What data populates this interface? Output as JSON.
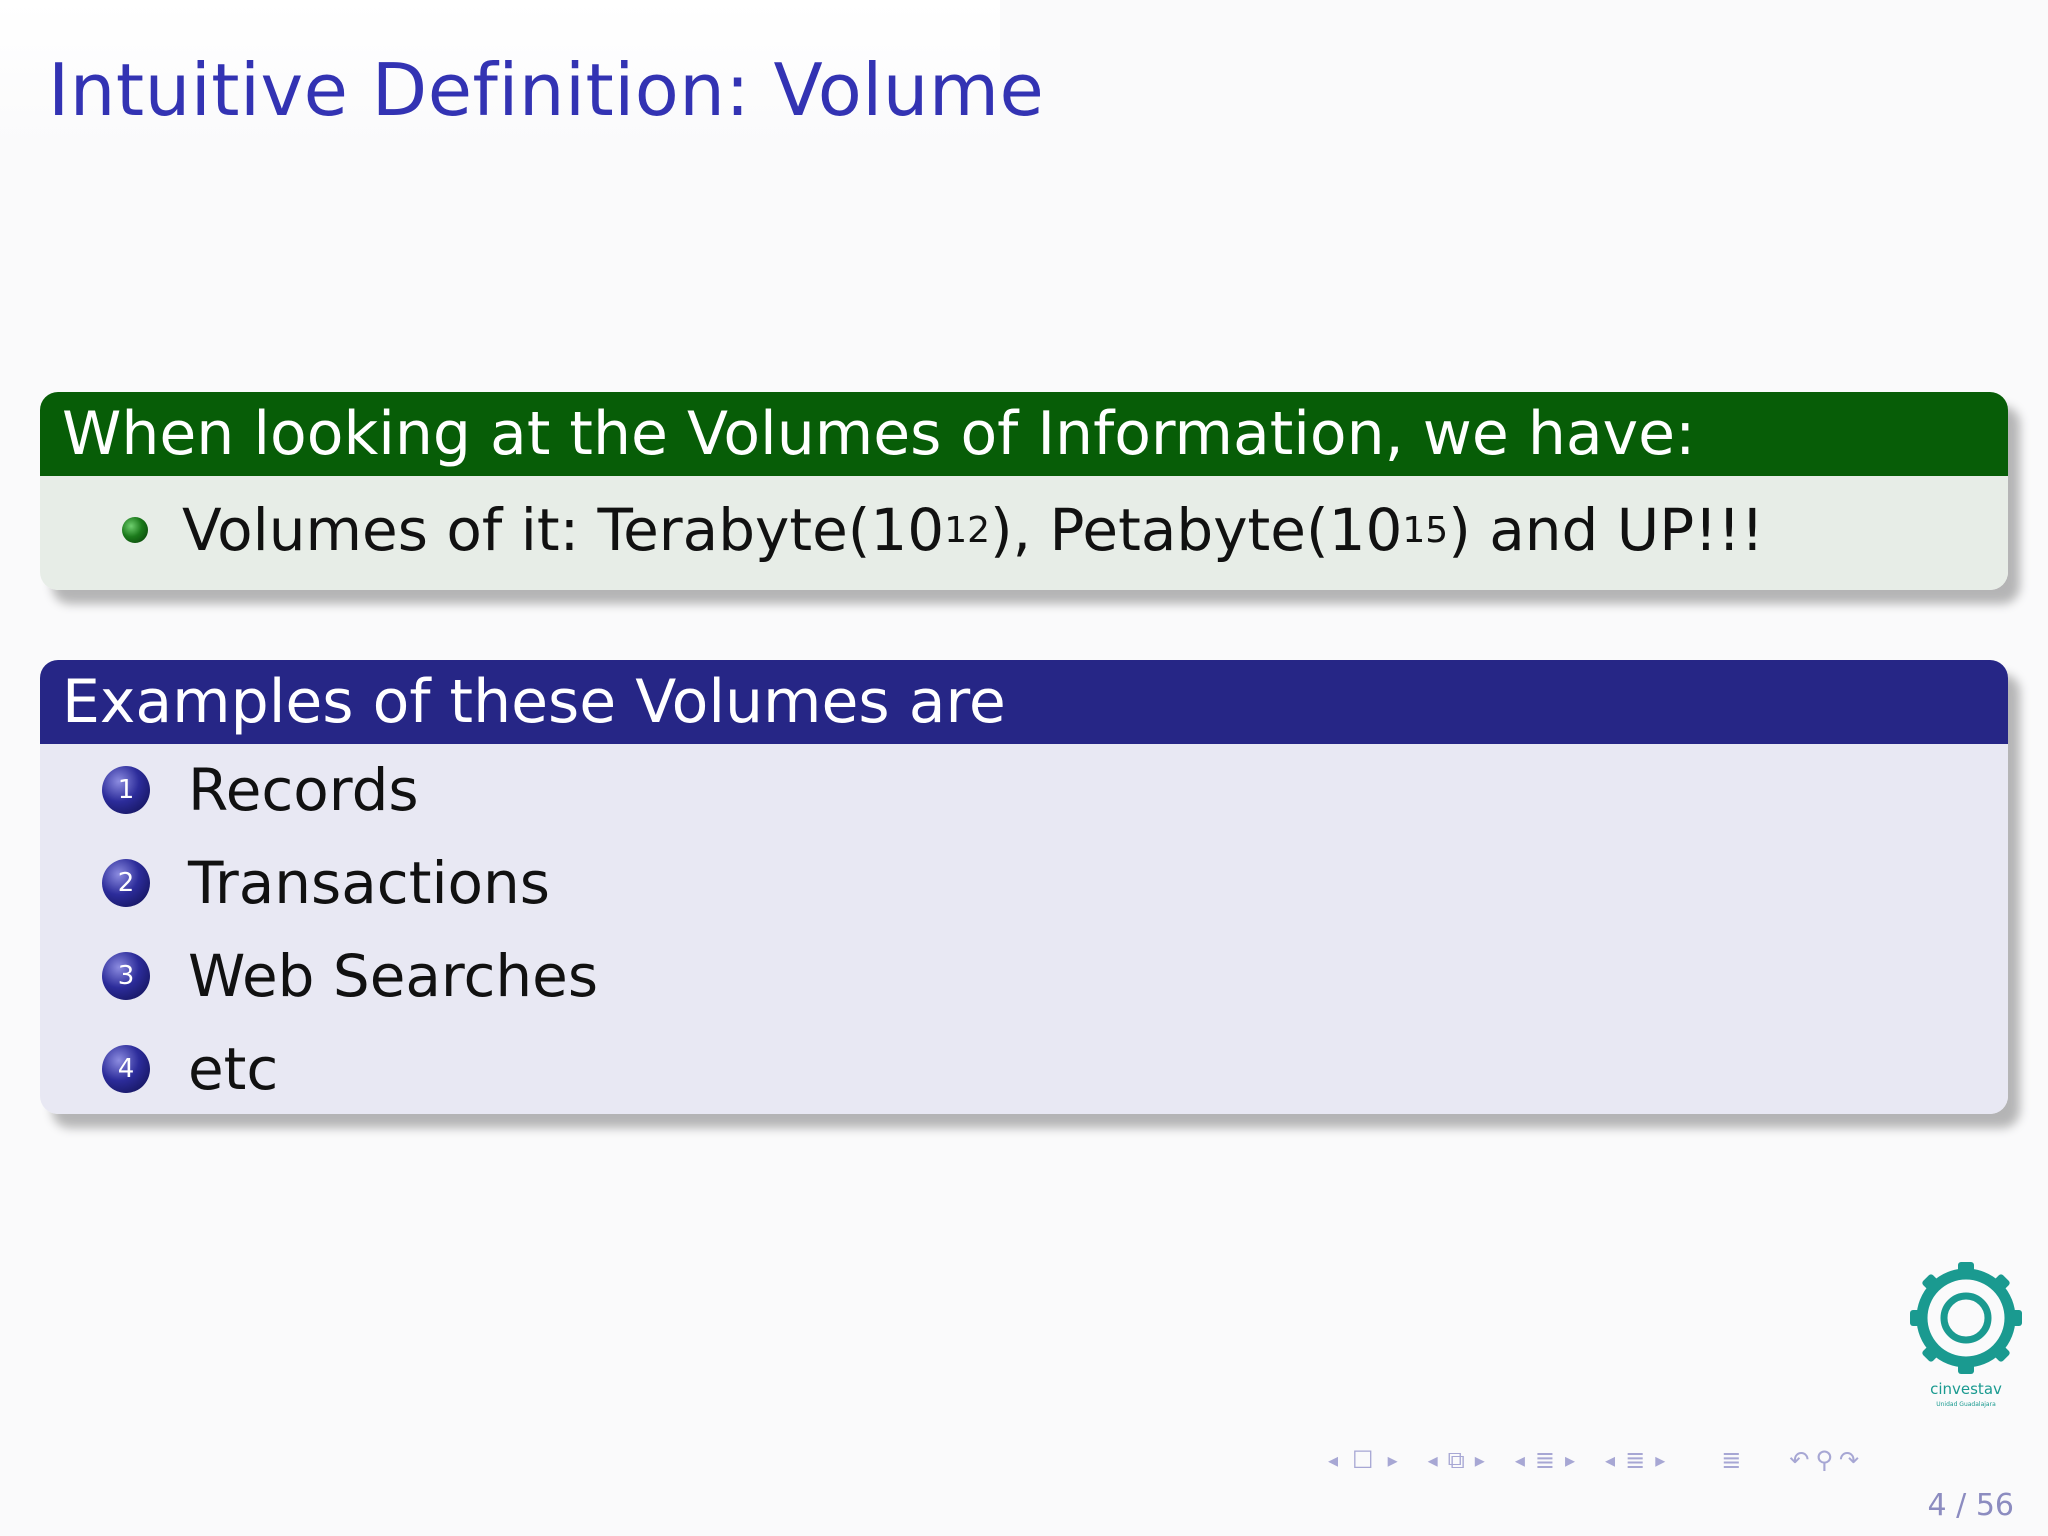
{
  "slide": {
    "title": "Intuitive Definition: Volume",
    "page_number": "4 / 56"
  },
  "block_green": {
    "header": "When looking at the Volumes of Information, we have:",
    "bullet": {
      "text_before": "Volumes of it: Terabyte(10",
      "sup1": "12",
      "text_middle": "), Petabyte(10",
      "sup2": "15",
      "text_after": ") and UP!!!"
    }
  },
  "block_blue": {
    "header": "Examples of these Volumes are",
    "items": [
      {
        "num": "1",
        "label": "Records"
      },
      {
        "num": "2",
        "label": "Transactions"
      },
      {
        "num": "3",
        "label": "Web Searches"
      },
      {
        "num": "4",
        "label": "etc"
      }
    ]
  },
  "logo": {
    "text": "cinvestav",
    "subtext": "Unidad Guadalajara",
    "color": "#1a9a90"
  },
  "colors": {
    "title": "#3333b3",
    "green_header": "#075d07",
    "blue_header": "#262686"
  }
}
